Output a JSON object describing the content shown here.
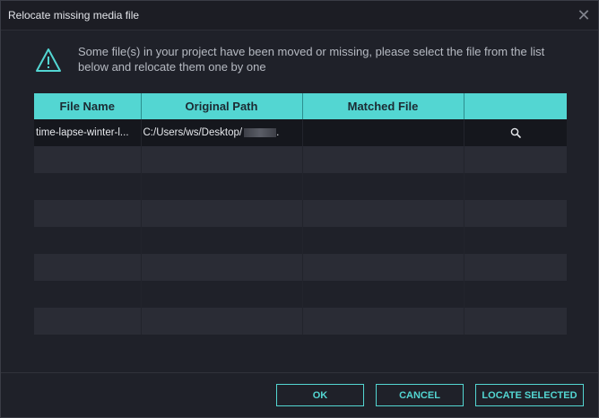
{
  "window": {
    "title": "Relocate missing media file",
    "close_icon": "close-icon"
  },
  "message": {
    "icon": "warning-triangle-icon",
    "text_line1": "Some file(s) in your project have been moved or missing, please select the file from the list",
    "text_line2": "below and relocate them one by one"
  },
  "table": {
    "columns": [
      "File Name",
      "Original Path",
      "Matched File",
      ""
    ],
    "rows": [
      {
        "file_name": "time-lapse-winter-l...",
        "original_path": "C:/Users/ws/Desktop/",
        "original_path_suffix": ".",
        "matched_file": "",
        "action_icon": "search-icon"
      }
    ],
    "empty_row_count": 7
  },
  "footer": {
    "ok_label": "OK",
    "cancel_label": "CANCEL",
    "locate_selected_label": "LOCATE SELECTED"
  },
  "colors": {
    "accent": "#53d6d2",
    "background": "#1f2129",
    "row_alt": "#2a2c35"
  }
}
